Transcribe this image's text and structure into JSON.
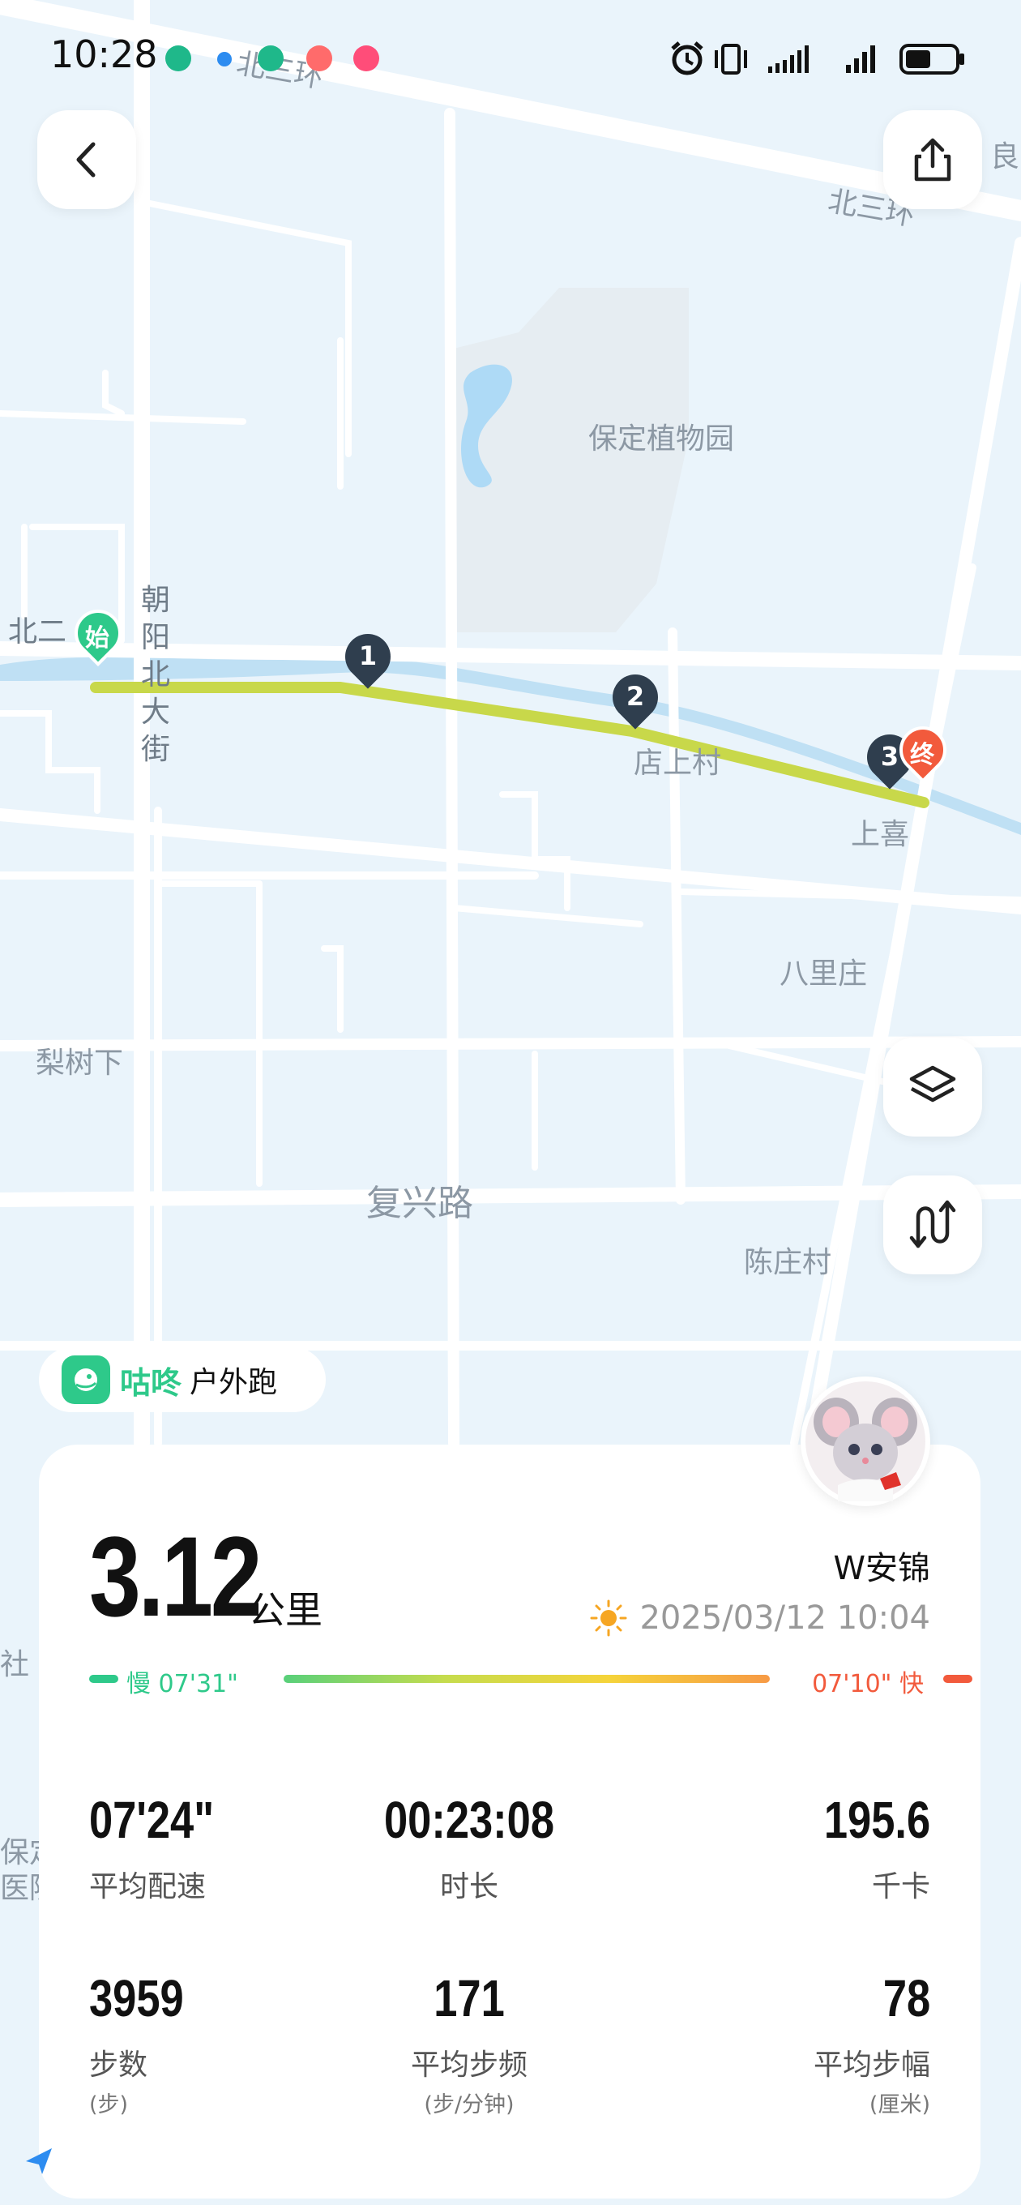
{
  "status_bar": {
    "time": "10:28",
    "icons": [
      "alarm-icon",
      "vibrate-icon",
      "signal-icon",
      "signal-icon",
      "battery-icon"
    ]
  },
  "map": {
    "labels": {
      "ring_road_top": "北三环",
      "ring_road_right": "北三环",
      "right_edge": "良",
      "botanical_garden": "保定植物园",
      "bei_er": "北二",
      "dianshang": "店上村",
      "shangxi": "上喜",
      "balizhuang": "八里庄",
      "lishuxia": "梨树下",
      "fuxing_road": "复兴路",
      "chenzhuang": "陈庄村",
      "she": "社",
      "baoding_1": "保定",
      "baoding_2": "医院"
    },
    "street_vertical": [
      "朝",
      "阳",
      "北",
      "大",
      "街"
    ],
    "markers": {
      "start": "始",
      "km1": "1",
      "km2": "2",
      "km3": "3",
      "end": "终"
    },
    "colors": {
      "route": "#c8d84a",
      "start": "#2ec98a",
      "end": "#f25a3c",
      "km_marker": "#2f3e4e"
    }
  },
  "app_tag": {
    "brand": "咕咚",
    "activity": "户外跑",
    "color": "#2ec98a"
  },
  "card": {
    "user_name": "W安锦",
    "distance": "3.12",
    "distance_unit": "公里",
    "datetime": "2025/03/12 10:04",
    "pace_bar": {
      "slow_label": "慢 07'31\"",
      "fast_label": "07'10\" 快",
      "slow_color": "#2ec98a",
      "fast_color": "#f25a3c"
    },
    "stats": [
      {
        "value": "07'24\"",
        "label": "平均配速",
        "sub": ""
      },
      {
        "value": "00:23:08",
        "label": "时长",
        "sub": ""
      },
      {
        "value": "195.6",
        "label": "千卡",
        "sub": ""
      },
      {
        "value": "3959",
        "label": "步数",
        "sub": "(步)"
      },
      {
        "value": "171",
        "label": "平均步频",
        "sub": "(步/分钟)"
      },
      {
        "value": "78",
        "label": "平均步幅",
        "sub": "(厘米)"
      }
    ]
  }
}
